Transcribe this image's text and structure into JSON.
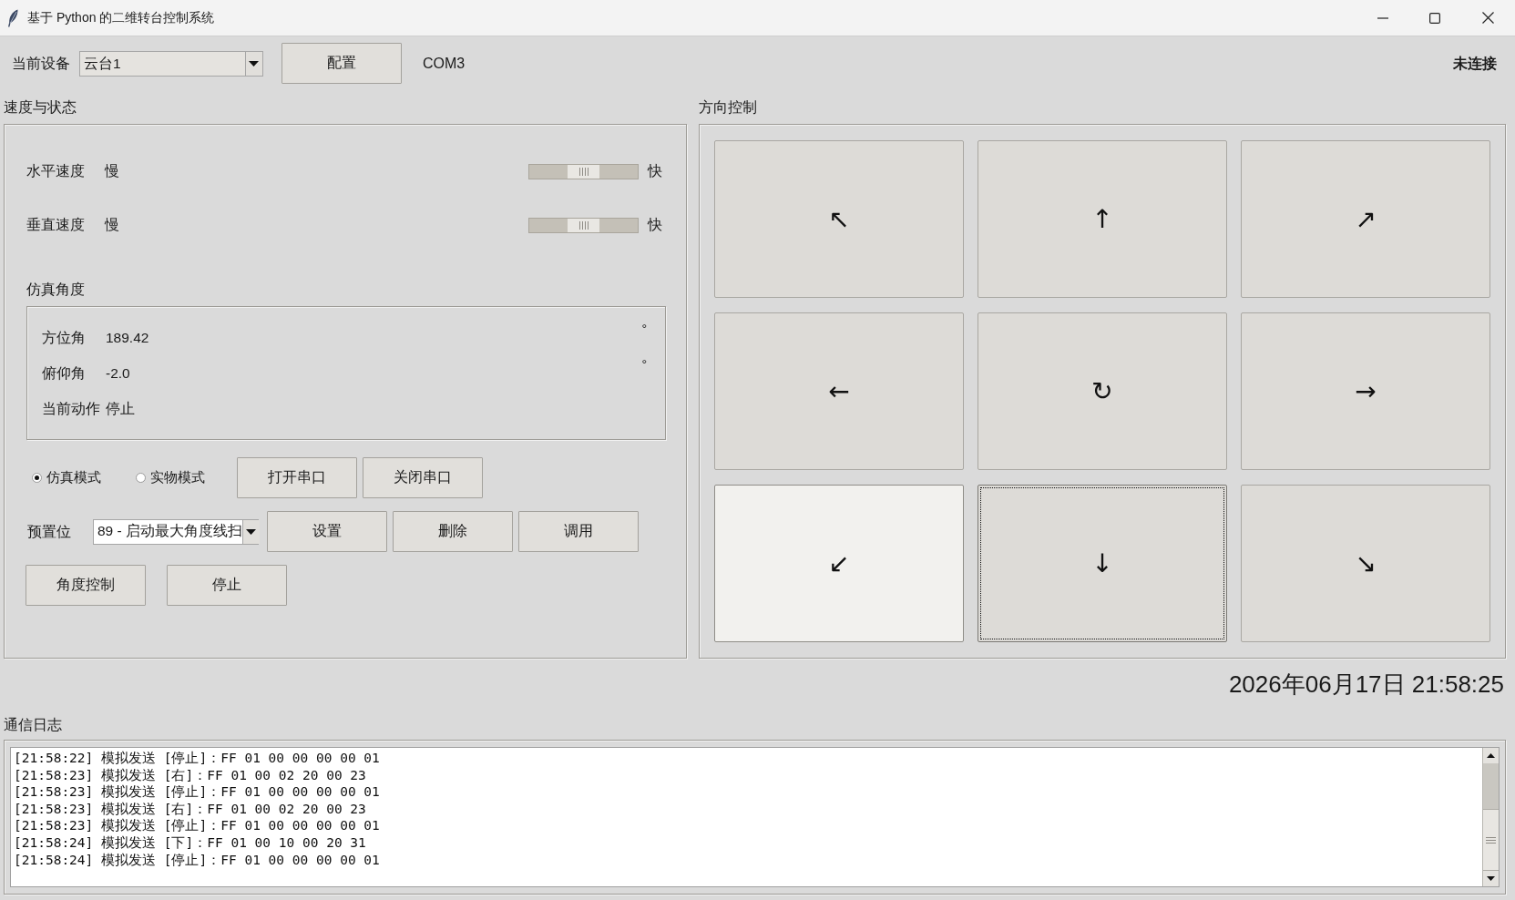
{
  "window": {
    "title": "基于 Python 的二维转台控制系统"
  },
  "toolbar": {
    "device_label": "当前设备",
    "device": "云台1",
    "config_button": "配置",
    "port": "COM3",
    "connection_status": "未连接"
  },
  "speed_panel": {
    "title": "速度与状态",
    "sliders": [
      {
        "label": "水平速度",
        "min_label": "慢",
        "max_label": "快",
        "level": 0.5
      },
      {
        "label": "垂直速度",
        "min_label": "慢",
        "max_label": "快",
        "level": 0.5
      }
    ],
    "angle_group": {
      "title": "仿真角度",
      "rows": [
        {
          "label": "方位角",
          "value": "189.42",
          "unit": "°"
        },
        {
          "label": "俯仰角",
          "value": "-2.0",
          "unit": "°"
        },
        {
          "label": "当前动作",
          "value": "停止"
        }
      ]
    },
    "modes": [
      {
        "label": "仿真模式",
        "selected": true
      },
      {
        "label": "实物模式",
        "selected": false
      }
    ],
    "port_buttons": [
      "打开串口",
      "关闭串口"
    ],
    "preset": {
      "label": "预置位",
      "value": "89 - 启动最大角度线扫",
      "buttons": [
        "设置",
        "删除",
        "调用"
      ]
    },
    "action_buttons": [
      "角度控制",
      "停止"
    ]
  },
  "direction_panel": {
    "title": "方向控制",
    "buttons": [
      {
        "symbol": "↖",
        "hovered": false,
        "focused": false
      },
      {
        "symbol": "↑",
        "hovered": false,
        "focused": false
      },
      {
        "symbol": "↗",
        "hovered": false,
        "focused": false
      },
      {
        "symbol": "←",
        "hovered": false,
        "focused": false
      },
      {
        "symbol": "↻",
        "hovered": false,
        "focused": false
      },
      {
        "symbol": "→",
        "hovered": false,
        "focused": false
      },
      {
        "symbol": "↙",
        "hovered": true,
        "focused": false
      },
      {
        "symbol": "↓",
        "hovered": false,
        "focused": true
      },
      {
        "symbol": "↘",
        "hovered": false,
        "focused": false
      }
    ]
  },
  "clock": "2026年06月17日 21:58:25",
  "log": {
    "title": "通信日志",
    "lines": [
      "[21:58:22] 模拟发送 [停止]：FF 01 00 00 00 00 01",
      "[21:58:23] 模拟发送 [右]：FF 01 00 02 20 00 23",
      "[21:58:23] 模拟发送 [停止]：FF 01 00 00 00 00 01",
      "[21:58:23] 模拟发送 [右]：FF 01 00 02 20 00 23",
      "[21:58:23] 模拟发送 [停止]：FF 01 00 00 00 00 01",
      "[21:58:24] 模拟发送 [下]：FF 01 00 10 00 20 31",
      "[21:58:24] 模拟发送 [停止]：FF 01 00 00 00 00 01"
    ]
  }
}
